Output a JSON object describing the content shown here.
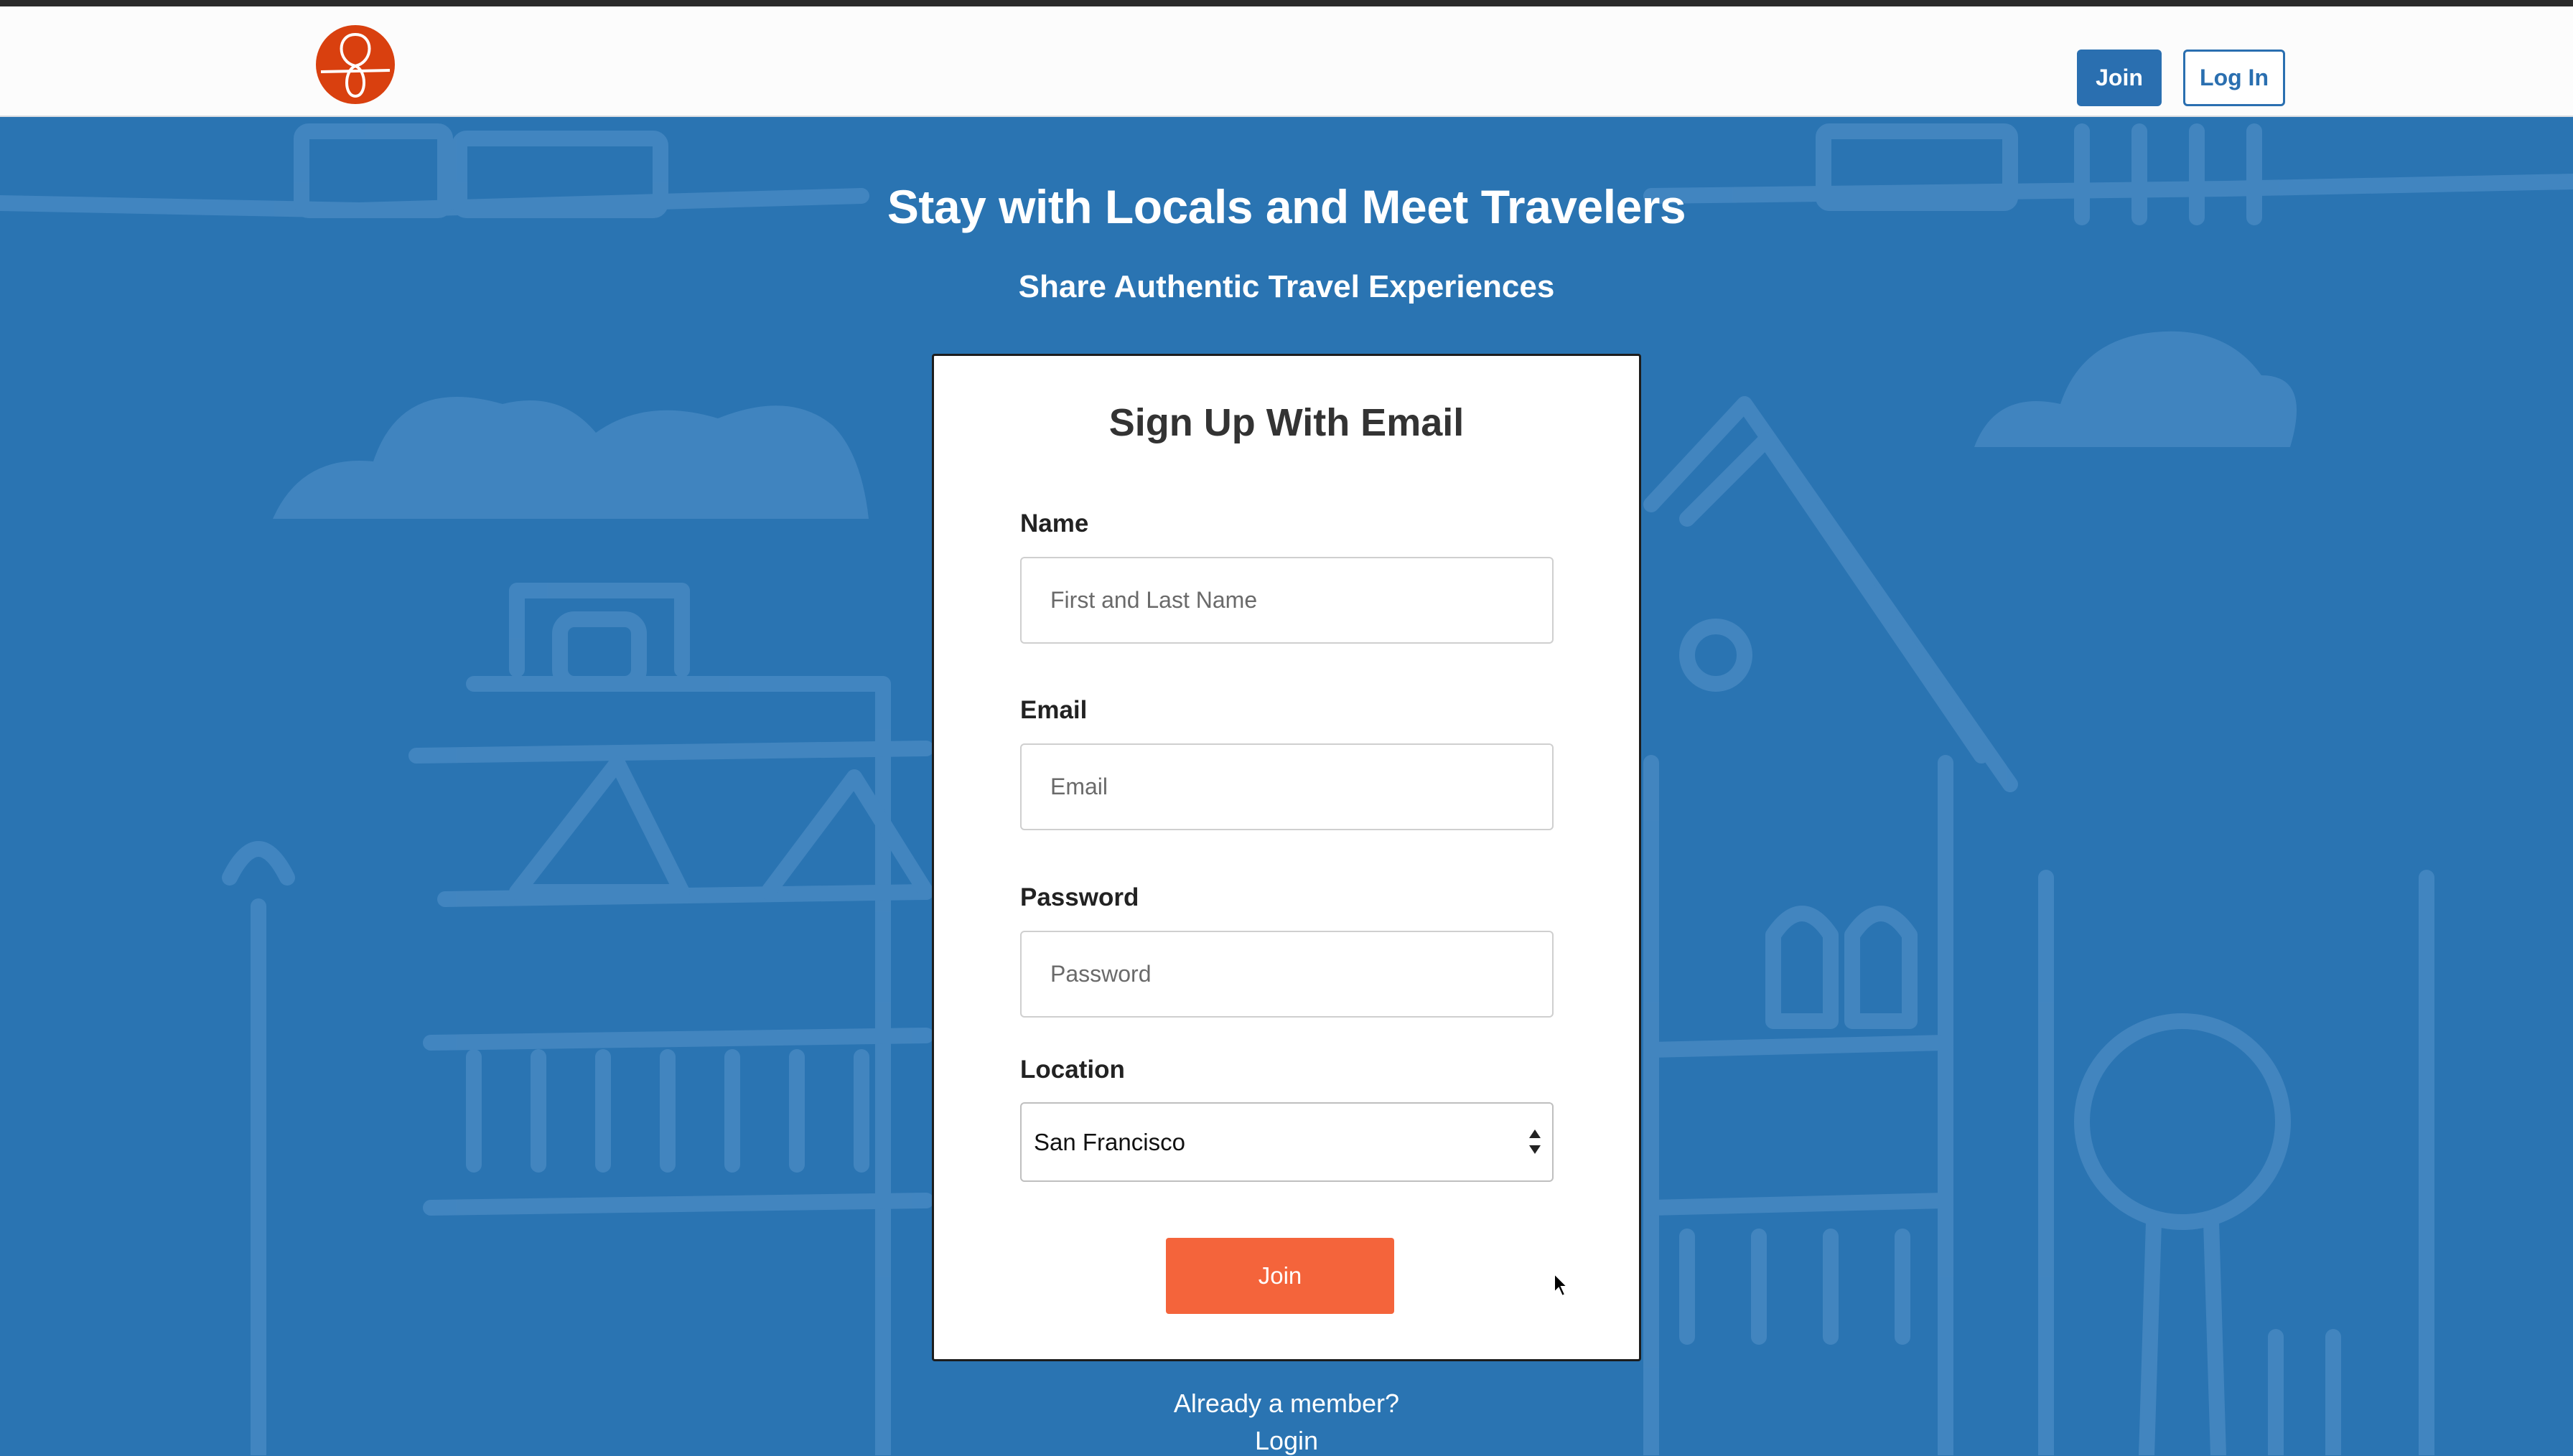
{
  "header": {
    "logo_icon": "couchsurfing-logo-icon",
    "join_label": "Join",
    "login_label": "Log In"
  },
  "hero": {
    "title": "Stay with Locals and Meet Travelers",
    "subtitle": "Share Authentic Travel Experiences"
  },
  "signup": {
    "title": "Sign Up With Email",
    "name_label": "Name",
    "name_placeholder": "First and Last Name",
    "email_label": "Email",
    "email_placeholder": "Email",
    "password_label": "Password",
    "password_placeholder": "Password",
    "location_label": "Location",
    "location_value": "San Francisco",
    "join_label": "Join"
  },
  "footer": {
    "already_text": "Already a member?",
    "login_text": "Login"
  },
  "colors": {
    "background": "#2a74b2",
    "primary_button": "#2a6fb0",
    "join_button": "#f4643b",
    "logo": "#d9400f"
  }
}
